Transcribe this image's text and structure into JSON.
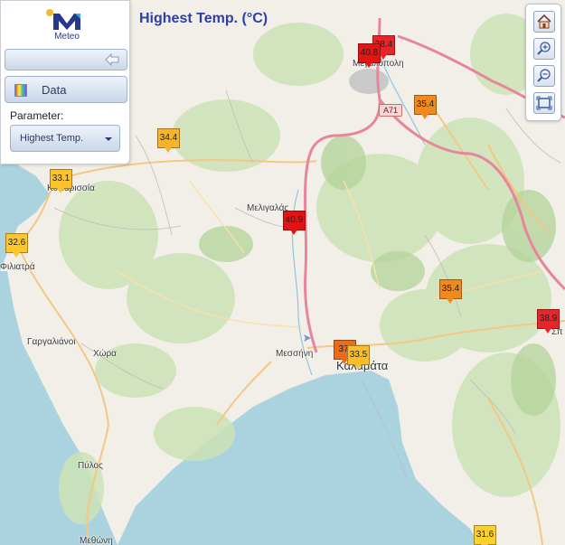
{
  "header": {
    "title": "Highest Temp. (°C)"
  },
  "panel": {
    "logo_text": "Meteo",
    "data_button_label": "Data",
    "parameter_label": "Parameter:",
    "parameter_value": "Highest Temp."
  },
  "toolbar": {
    "icons": [
      "home-icon",
      "zoom-in-icon",
      "zoom-out-icon",
      "full-extent-icon"
    ]
  },
  "places": {
    "megalopoli": "Μεγαλόπολη",
    "kyparissia": "Κυπαρισσία",
    "filiatra": "Φιλιατρά",
    "meligalas": "Μελιγαλάς",
    "gargaliani": "Γαργαλιάνοι",
    "chora": "Χώρα",
    "messini": "Μεσσήνη",
    "kalamata": "Καλαμάτα",
    "pylos": "Πύλος",
    "methoni": "Μεθώνη",
    "sparti": "Σπ"
  },
  "road_label": "A71",
  "stations": [
    {
      "value": "38.4",
      "color": "#e8262a"
    },
    {
      "value": "40.8",
      "color": "#e41414"
    },
    {
      "value": "35.4",
      "color": "#f08a1e"
    },
    {
      "value": "34.4",
      "color": "#f7b32a"
    },
    {
      "value": "33.1",
      "color": "#fbc22b"
    },
    {
      "value": "32.6",
      "color": "#fcc72d"
    },
    {
      "value": "40.9",
      "color": "#e31313"
    },
    {
      "value": "35.4",
      "color": "#f08a1e"
    },
    {
      "value": "38.9",
      "color": "#e8262a"
    },
    {
      "value": "37.",
      "color": "#ec6a1d"
    },
    {
      "value": "33.5",
      "color": "#fbbe2a"
    },
    {
      "value": "31.6",
      "color": "#fdd030"
    }
  ],
  "colors": {
    "sea": "#aad3df",
    "land": "#f2efe9",
    "forest": "#c8dfb0",
    "primary_road": "#e892a2",
    "secondary_road": "#f7cf8e",
    "title": "#2d3ea8"
  }
}
